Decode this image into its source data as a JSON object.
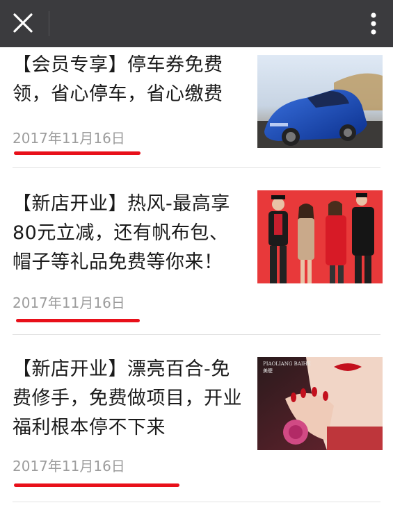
{
  "topbar": {
    "close_icon": "close-icon",
    "more_icon": "more-vertical-icon",
    "bar_color": "#3b3b3e"
  },
  "articles": [
    {
      "title": "【会员专享】停车券免费领，省心停车，省心缴费",
      "date": "2017年11月16日",
      "thumb": "blue-sports-car-image"
    },
    {
      "title": "【新店开业】热风-最高享80元立减，还有帆布包、帽子等礼品免费等你来！",
      "date": "2017年11月16日",
      "thumb": "fashion-models-red-background-image"
    },
    {
      "title": "【新店开业】漂亮百合-免费修手，免费做项目，开业福利根本停不下来",
      "date": "2017年11月16日",
      "thumb": "red-nails-lips-beauty-image",
      "thumb_logo": "PIAOLIANG BAIHE",
      "thumb_logo_cn": "美睫"
    }
  ],
  "colors": {
    "underline": "#e8101a",
    "date_text": "#9c9c9c",
    "title_text": "#1a1a1a"
  }
}
